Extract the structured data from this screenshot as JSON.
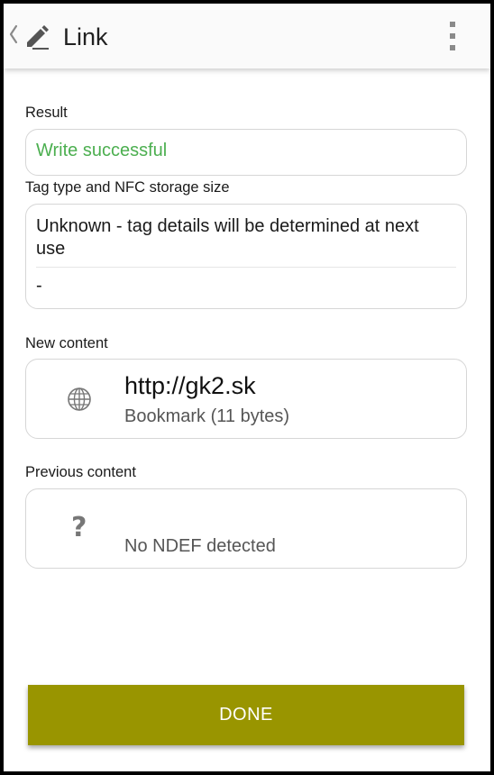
{
  "appbar": {
    "title": "Link",
    "back_icon": "chevron-left-icon",
    "app_icon": "pencil-icon",
    "menu_icon": "overflow-menu-icon"
  },
  "result": {
    "label": "Result",
    "value": "Write successful",
    "value_color": "#4caf50"
  },
  "tag": {
    "label": "Tag type and NFC storage size",
    "value": "Unknown - tag details will be determined at next use",
    "size": "-"
  },
  "new_content": {
    "label": "New content",
    "icon": "globe-icon",
    "title": "http://gk2.sk",
    "subtitle": "Bookmark (11 bytes)"
  },
  "previous_content": {
    "label": "Previous content",
    "icon": "question-mark-icon",
    "icon_glyph": "?",
    "subtitle": "No NDEF detected"
  },
  "done_button": {
    "label": "DONE",
    "color": "#999500"
  }
}
